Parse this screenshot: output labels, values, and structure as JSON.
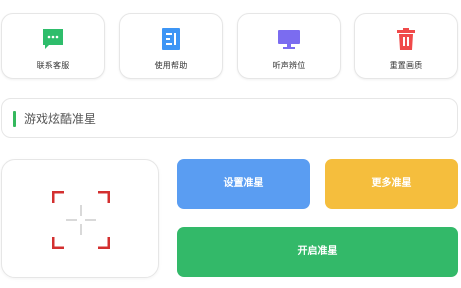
{
  "cards": [
    {
      "label": "联系客服",
      "icon": "chat-icon",
      "color": "#2ebd6b"
    },
    {
      "label": "使用帮助",
      "icon": "help-doc-icon",
      "color": "#3d95f5"
    },
    {
      "label": "听声辨位",
      "icon": "monitor-icon",
      "color": "#7b6cf0"
    },
    {
      "label": "重置画质",
      "icon": "trash-icon",
      "color": "#f04a4a"
    }
  ],
  "banner": {
    "text": "游戏炫酷准星",
    "accent_color": "#34b85d"
  },
  "preview": {
    "crosshair_icon": "crosshair-icon",
    "corner_color": "#d32f2f"
  },
  "buttons": {
    "set": "设置准星",
    "more": "更多准星",
    "open": "开启准星"
  },
  "colors": {
    "set_button": "#5a9df2",
    "more_button": "#f5be3d",
    "open_button": "#33b969"
  }
}
